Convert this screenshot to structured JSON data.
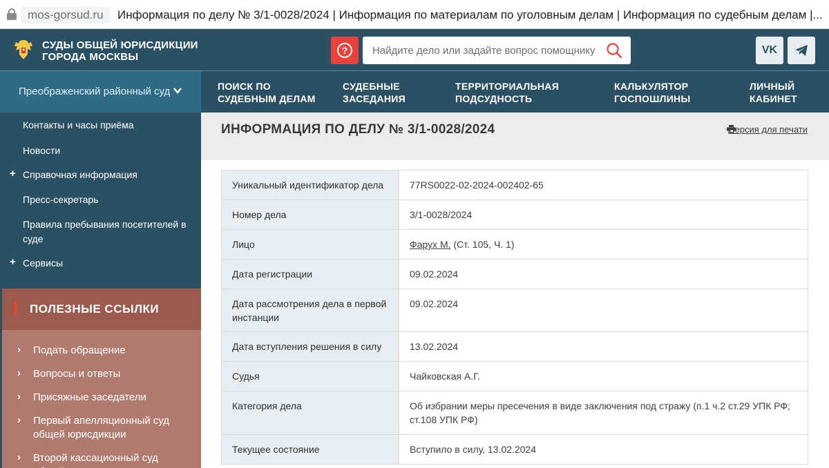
{
  "browser": {
    "domain": "mos-gorsud.ru",
    "title": "Информация по делу № 3/1-0028/2024 | Информация по материалам по уголовным делам | Информация по судебным делам |..."
  },
  "header": {
    "site_title_line1": "СУДЫ ОБЩЕЙ ЮРИСДИКЦИИ",
    "site_title_line2": "ГОРОДА МОСКВЫ",
    "help_symbol": "?",
    "search_placeholder": "Найдите дело или задайте вопрос помощнику",
    "social_vk": "VK",
    "social_tg": "telegram-icon"
  },
  "sidebar": {
    "court": "Преображенский районный суд",
    "items": [
      {
        "label": "Контакты и часы приёма",
        "expandable": false
      },
      {
        "label": "Новости",
        "expandable": false
      },
      {
        "label": "Справочная информация",
        "expandable": true
      },
      {
        "label": "Пресс-секретарь",
        "expandable": false
      },
      {
        "label": "Правила пребывания посетителей в суде",
        "expandable": false
      },
      {
        "label": "Сервисы",
        "expandable": true
      }
    ],
    "useful_links_title": "ПОЛЕЗНЫЕ ССЫЛКИ",
    "links": [
      "Подать обращение",
      "Вопросы и ответы",
      "Присяжные заседатели",
      "Первый апелляционный суд общей юрисдикции",
      "Второй кассационный суд общей"
    ]
  },
  "nav": [
    {
      "line1": "ПОИСК ПО",
      "line2": "СУДЕБНЫМ ДЕЛАМ"
    },
    {
      "line1": "СУДЕБНЫЕ",
      "line2": "ЗАСЕДАНИЯ"
    },
    {
      "line1": "ТЕРРИТОРИАЛЬНАЯ",
      "line2": "ПОДСУДНОСТЬ"
    },
    {
      "line1": "КАЛЬКУЛЯТОР",
      "line2": "ГОСПОШЛИНЫ"
    },
    {
      "line1": "ЛИЧНЫЙ",
      "line2": "КАБИНЕТ"
    }
  ],
  "main": {
    "title": "ИНФОРМАЦИЯ ПО ДЕЛУ № 3/1-0028/2024",
    "print_label": "Версия для печати",
    "rows": [
      {
        "label": "Уникальный идентификатор дела",
        "value": "77RS0022-02-2024-002402-65"
      },
      {
        "label": "Номер дела",
        "value": "3/1-0028/2024"
      },
      {
        "label": "Лицо",
        "person": "Фарух М.",
        "value": "(Ст. 105, Ч. 1)"
      },
      {
        "label": "Дата регистрации",
        "value": "09.02.2024"
      },
      {
        "label": "Дата рассмотрения дела в первой инстанции",
        "value": "09.02.2024"
      },
      {
        "label": "Дата вступления решения в силу",
        "value": "13.02.2024"
      },
      {
        "label": "Судья",
        "value": "Чайковская А.Г."
      },
      {
        "label": "Категория дела",
        "value": "Об избрании меры пресечения в виде заключения под стражу (п.1 ч.2 ст.29 УПК РФ; ст.108 УПК РФ)"
      },
      {
        "label": "Текущее состояние",
        "value": "Вступило в силу, 13.02.2024"
      }
    ]
  },
  "colors": {
    "header_bg": "#2c5063",
    "court_select_bg": "#2f6b85",
    "help_button": "#e8423b",
    "links_header": "#9a5a4e",
    "links_bg": "#b07a6e",
    "label_cell_bg": "#e8edf1"
  }
}
